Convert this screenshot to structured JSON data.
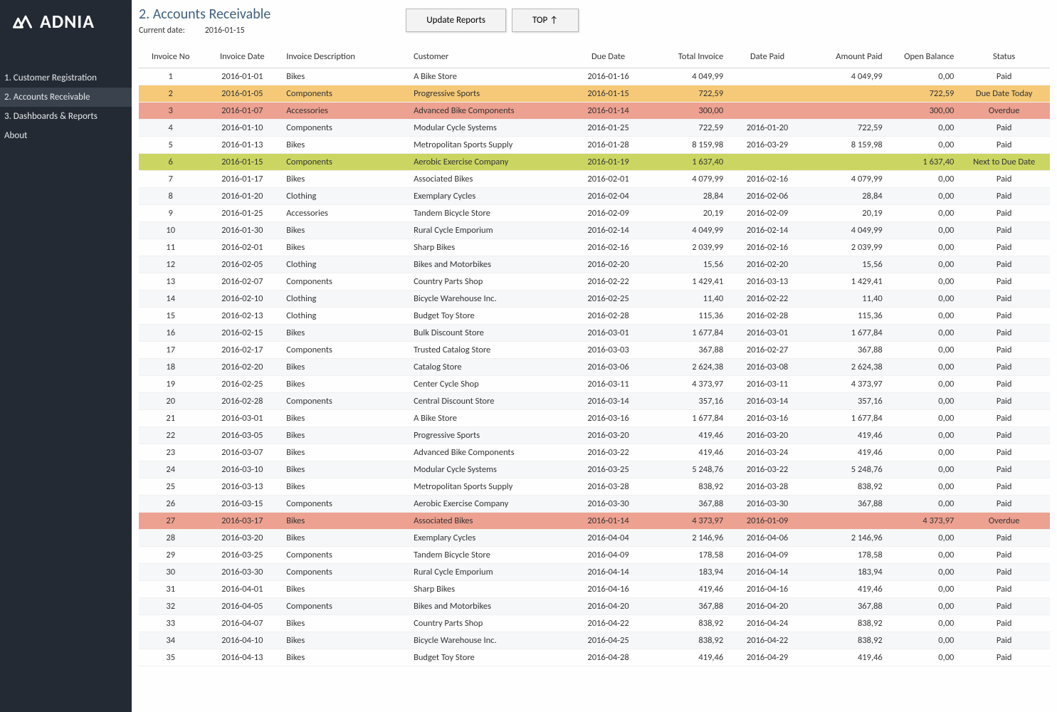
{
  "logo_text": "ADNIA",
  "nav": [
    {
      "label": "1. Customer Registration",
      "active": false
    },
    {
      "label": "2. Accounts Receivable",
      "active": true
    },
    {
      "label": "3. Dashboards & Reports",
      "active": false
    },
    {
      "label": "About",
      "active": false
    }
  ],
  "page_title": "2. Accounts Receivable",
  "current_date_label": "Current date:",
  "current_date_value": "2016-01-15",
  "buttons": {
    "update": "Update Reports",
    "top": "TOP ↑"
  },
  "columns": [
    "Invoice No",
    "Invoice Date",
    "Invoice Description",
    "Customer",
    "Due Date",
    "Total Invoice",
    "Date Paid",
    "Amount Paid",
    "Open Balance",
    "Status"
  ],
  "rows": [
    {
      "no": "1",
      "idate": "2016-01-01",
      "desc": "Bikes",
      "cust": "A Bike Store",
      "due": "2016-01-16",
      "total": "4 049,99",
      "paiddate": "",
      "amtpaid": "4 049,99",
      "open": "0,00",
      "status": "Paid"
    },
    {
      "no": "2",
      "idate": "2016-01-05",
      "desc": "Components",
      "cust": "Progressive Sports",
      "due": "2016-01-15",
      "total": "722,59",
      "paiddate": "",
      "amtpaid": "",
      "open": "722,59",
      "status": "Due Date Today"
    },
    {
      "no": "3",
      "idate": "2016-01-07",
      "desc": "Accessories",
      "cust": "Advanced Bike Components",
      "due": "2016-01-14",
      "total": "300,00",
      "paiddate": "",
      "amtpaid": "",
      "open": "300,00",
      "status": "Overdue"
    },
    {
      "no": "4",
      "idate": "2016-01-10",
      "desc": "Components",
      "cust": "Modular Cycle Systems",
      "due": "2016-01-25",
      "total": "722,59",
      "paiddate": "2016-01-20",
      "amtpaid": "722,59",
      "open": "0,00",
      "status": "Paid"
    },
    {
      "no": "5",
      "idate": "2016-01-13",
      "desc": "Bikes",
      "cust": "Metropolitan Sports Supply",
      "due": "2016-01-28",
      "total": "8 159,98",
      "paiddate": "2016-03-29",
      "amtpaid": "8 159,98",
      "open": "0,00",
      "status": "Paid"
    },
    {
      "no": "6",
      "idate": "2016-01-15",
      "desc": "Components",
      "cust": "Aerobic Exercise Company",
      "due": "2016-01-19",
      "total": "1 637,40",
      "paiddate": "",
      "amtpaid": "",
      "open": "1 637,40",
      "status": "Next to Due Date"
    },
    {
      "no": "7",
      "idate": "2016-01-17",
      "desc": "Bikes",
      "cust": "Associated Bikes",
      "due": "2016-02-01",
      "total": "4 079,99",
      "paiddate": "2016-02-16",
      "amtpaid": "4 079,99",
      "open": "0,00",
      "status": "Paid"
    },
    {
      "no": "8",
      "idate": "2016-01-20",
      "desc": "Clothing",
      "cust": "Exemplary Cycles",
      "due": "2016-02-04",
      "total": "28,84",
      "paiddate": "2016-02-06",
      "amtpaid": "28,84",
      "open": "0,00",
      "status": "Paid"
    },
    {
      "no": "9",
      "idate": "2016-01-25",
      "desc": "Accessories",
      "cust": "Tandem Bicycle Store",
      "due": "2016-02-09",
      "total": "20,19",
      "paiddate": "2016-02-09",
      "amtpaid": "20,19",
      "open": "0,00",
      "status": "Paid"
    },
    {
      "no": "10",
      "idate": "2016-01-30",
      "desc": "Bikes",
      "cust": "Rural Cycle Emporium",
      "due": "2016-02-14",
      "total": "4 049,99",
      "paiddate": "2016-02-14",
      "amtpaid": "4 049,99",
      "open": "0,00",
      "status": "Paid"
    },
    {
      "no": "11",
      "idate": "2016-02-01",
      "desc": "Bikes",
      "cust": "Sharp Bikes",
      "due": "2016-02-16",
      "total": "2 039,99",
      "paiddate": "2016-02-16",
      "amtpaid": "2 039,99",
      "open": "0,00",
      "status": "Paid"
    },
    {
      "no": "12",
      "idate": "2016-02-05",
      "desc": "Clothing",
      "cust": "Bikes and Motorbikes",
      "due": "2016-02-20",
      "total": "15,56",
      "paiddate": "2016-02-20",
      "amtpaid": "15,56",
      "open": "0,00",
      "status": "Paid"
    },
    {
      "no": "13",
      "idate": "2016-02-07",
      "desc": "Components",
      "cust": "Country Parts Shop",
      "due": "2016-02-22",
      "total": "1 429,41",
      "paiddate": "2016-03-13",
      "amtpaid": "1 429,41",
      "open": "0,00",
      "status": "Paid"
    },
    {
      "no": "14",
      "idate": "2016-02-10",
      "desc": "Clothing",
      "cust": "Bicycle Warehouse Inc.",
      "due": "2016-02-25",
      "total": "11,40",
      "paiddate": "2016-02-22",
      "amtpaid": "11,40",
      "open": "0,00",
      "status": "Paid"
    },
    {
      "no": "15",
      "idate": "2016-02-13",
      "desc": "Clothing",
      "cust": "Budget Toy Store",
      "due": "2016-02-28",
      "total": "115,36",
      "paiddate": "2016-02-28",
      "amtpaid": "115,36",
      "open": "0,00",
      "status": "Paid"
    },
    {
      "no": "16",
      "idate": "2016-02-15",
      "desc": "Bikes",
      "cust": "Bulk Discount Store",
      "due": "2016-03-01",
      "total": "1 677,84",
      "paiddate": "2016-03-01",
      "amtpaid": "1 677,84",
      "open": "0,00",
      "status": "Paid"
    },
    {
      "no": "17",
      "idate": "2016-02-17",
      "desc": "Components",
      "cust": "Trusted Catalog Store",
      "due": "2016-03-03",
      "total": "367,88",
      "paiddate": "2016-02-27",
      "amtpaid": "367,88",
      "open": "0,00",
      "status": "Paid"
    },
    {
      "no": "18",
      "idate": "2016-02-20",
      "desc": "Bikes",
      "cust": "Catalog Store",
      "due": "2016-03-06",
      "total": "2 624,38",
      "paiddate": "2016-03-08",
      "amtpaid": "2 624,38",
      "open": "0,00",
      "status": "Paid"
    },
    {
      "no": "19",
      "idate": "2016-02-25",
      "desc": "Bikes",
      "cust": "Center Cycle Shop",
      "due": "2016-03-11",
      "total": "4 373,97",
      "paiddate": "2016-03-11",
      "amtpaid": "4 373,97",
      "open": "0,00",
      "status": "Paid"
    },
    {
      "no": "20",
      "idate": "2016-02-28",
      "desc": "Components",
      "cust": "Central Discount Store",
      "due": "2016-03-14",
      "total": "357,16",
      "paiddate": "2016-03-14",
      "amtpaid": "357,16",
      "open": "0,00",
      "status": "Paid"
    },
    {
      "no": "21",
      "idate": "2016-03-01",
      "desc": "Bikes",
      "cust": "A Bike Store",
      "due": "2016-03-16",
      "total": "1 677,84",
      "paiddate": "2016-03-16",
      "amtpaid": "1 677,84",
      "open": "0,00",
      "status": "Paid"
    },
    {
      "no": "22",
      "idate": "2016-03-05",
      "desc": "Bikes",
      "cust": "Progressive Sports",
      "due": "2016-03-20",
      "total": "419,46",
      "paiddate": "2016-03-20",
      "amtpaid": "419,46",
      "open": "0,00",
      "status": "Paid"
    },
    {
      "no": "23",
      "idate": "2016-03-07",
      "desc": "Bikes",
      "cust": "Advanced Bike Components",
      "due": "2016-03-22",
      "total": "419,46",
      "paiddate": "2016-03-24",
      "amtpaid": "419,46",
      "open": "0,00",
      "status": "Paid"
    },
    {
      "no": "24",
      "idate": "2016-03-10",
      "desc": "Bikes",
      "cust": "Modular Cycle Systems",
      "due": "2016-03-25",
      "total": "5 248,76",
      "paiddate": "2016-03-22",
      "amtpaid": "5 248,76",
      "open": "0,00",
      "status": "Paid"
    },
    {
      "no": "25",
      "idate": "2016-03-13",
      "desc": "Bikes",
      "cust": "Metropolitan Sports Supply",
      "due": "2016-03-28",
      "total": "838,92",
      "paiddate": "2016-03-28",
      "amtpaid": "838,92",
      "open": "0,00",
      "status": "Paid"
    },
    {
      "no": "26",
      "idate": "2016-03-15",
      "desc": "Components",
      "cust": "Aerobic Exercise Company",
      "due": "2016-03-30",
      "total": "367,88",
      "paiddate": "2016-03-30",
      "amtpaid": "367,88",
      "open": "0,00",
      "status": "Paid"
    },
    {
      "no": "27",
      "idate": "2016-03-17",
      "desc": "Bikes",
      "cust": "Associated Bikes",
      "due": "2016-01-14",
      "total": "4 373,97",
      "paiddate": "2016-01-09",
      "amtpaid": "",
      "open": "4 373,97",
      "status": "Overdue"
    },
    {
      "no": "28",
      "idate": "2016-03-20",
      "desc": "Bikes",
      "cust": "Exemplary Cycles",
      "due": "2016-04-04",
      "total": "2 146,96",
      "paiddate": "2016-04-06",
      "amtpaid": "2 146,96",
      "open": "0,00",
      "status": "Paid"
    },
    {
      "no": "29",
      "idate": "2016-03-25",
      "desc": "Components",
      "cust": "Tandem Bicycle Store",
      "due": "2016-04-09",
      "total": "178,58",
      "paiddate": "2016-04-09",
      "amtpaid": "178,58",
      "open": "0,00",
      "status": "Paid"
    },
    {
      "no": "30",
      "idate": "2016-03-30",
      "desc": "Components",
      "cust": "Rural Cycle Emporium",
      "due": "2016-04-14",
      "total": "183,94",
      "paiddate": "2016-04-14",
      "amtpaid": "183,94",
      "open": "0,00",
      "status": "Paid"
    },
    {
      "no": "31",
      "idate": "2016-04-01",
      "desc": "Bikes",
      "cust": "Sharp Bikes",
      "due": "2016-04-16",
      "total": "419,46",
      "paiddate": "2016-04-16",
      "amtpaid": "419,46",
      "open": "0,00",
      "status": "Paid"
    },
    {
      "no": "32",
      "idate": "2016-04-05",
      "desc": "Components",
      "cust": "Bikes and Motorbikes",
      "due": "2016-04-20",
      "total": "367,88",
      "paiddate": "2016-04-20",
      "amtpaid": "367,88",
      "open": "0,00",
      "status": "Paid"
    },
    {
      "no": "33",
      "idate": "2016-04-07",
      "desc": "Bikes",
      "cust": "Country Parts Shop",
      "due": "2016-04-22",
      "total": "838,92",
      "paiddate": "2016-04-24",
      "amtpaid": "838,92",
      "open": "0,00",
      "status": "Paid"
    },
    {
      "no": "34",
      "idate": "2016-04-10",
      "desc": "Bikes",
      "cust": "Bicycle Warehouse Inc.",
      "due": "2016-04-25",
      "total": "838,92",
      "paiddate": "2016-04-22",
      "amtpaid": "838,92",
      "open": "0,00",
      "status": "Paid"
    },
    {
      "no": "35",
      "idate": "2016-04-13",
      "desc": "Bikes",
      "cust": "Budget Toy Store",
      "due": "2016-04-28",
      "total": "419,46",
      "paiddate": "2016-04-29",
      "amtpaid": "419,46",
      "open": "0,00",
      "status": "Paid"
    }
  ]
}
